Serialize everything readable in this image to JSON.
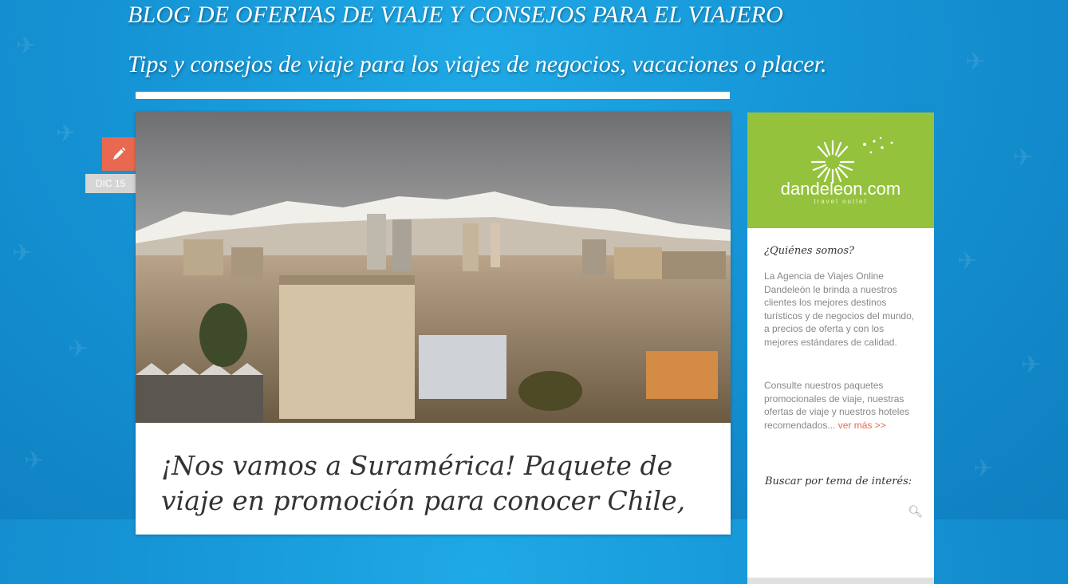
{
  "header": {
    "title": "BLOG DE OFERTAS DE VIAJE Y CONSEJOS PARA EL VIAJERO",
    "description": "Tips y consejos de viaje para los viajes de negocios, vacaciones o placer."
  },
  "post": {
    "date": "DIC 15",
    "title": "¡Nos vamos a Suramérica! Paquete de viaje en promoción para conocer Chile,",
    "image_icon": "city-skyline-photo"
  },
  "sidebar": {
    "logo_text": "dandeleon.com",
    "logo_tagline": "travel outlet",
    "about_heading": "¿Quiénes somos?",
    "about_text": "La Agencia de Viajes Online Dandeleón le brinda a nuestros clientes los mejores destinos turísticos y de negocios del mundo, a precios de oferta y con los mejores estándares de calidad.",
    "promo_text": "Consulte nuestros paquetes promocionales de viaje, nuestras ofertas de viaje y nuestros hoteles recomendados...",
    "more_link": "ver más >>",
    "search_label": "Buscar por tema de interés:"
  },
  "colors": {
    "background": "#1593d4",
    "accent": "#e8694f",
    "logo_bg": "#95c23d"
  }
}
